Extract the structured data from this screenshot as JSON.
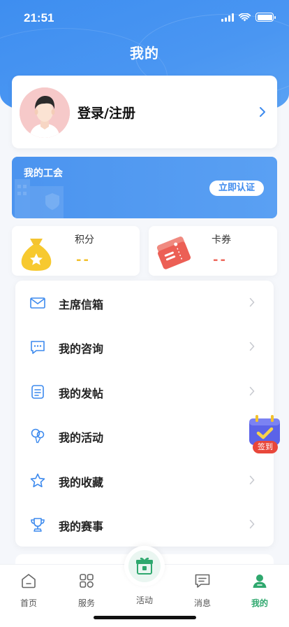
{
  "status_bar": {
    "time": "21:51"
  },
  "header": {
    "title": "我的"
  },
  "profile": {
    "login_label": "登录/注册"
  },
  "union": {
    "title": "我的工会",
    "verify_label": "立即认证"
  },
  "stats": {
    "points": {
      "label": "积分",
      "value": "--",
      "color": "#f2c12e"
    },
    "coupons": {
      "label": "卡券",
      "value": "--",
      "color": "#ee6b5f"
    }
  },
  "menu": {
    "items": [
      {
        "label": "主席信箱",
        "icon": "mail-icon"
      },
      {
        "label": "我的咨询",
        "icon": "chat-icon"
      },
      {
        "label": "我的发帖",
        "icon": "document-icon"
      },
      {
        "label": "我的活动",
        "icon": "balloon-icon"
      },
      {
        "label": "我的收藏",
        "icon": "star-icon"
      },
      {
        "label": "我的赛事",
        "icon": "trophy-icon"
      }
    ]
  },
  "signin": {
    "label": "签到"
  },
  "tabbar": {
    "tabs": [
      {
        "label": "首页",
        "icon": "home-icon"
      },
      {
        "label": "服务",
        "icon": "grid-icon"
      },
      {
        "label": "活动",
        "icon": "gift-icon"
      },
      {
        "label": "消息",
        "icon": "message-icon"
      },
      {
        "label": "我的",
        "icon": "person-icon",
        "active": true
      }
    ]
  },
  "colors": {
    "accent": "#3e8ef0",
    "active_tab": "#2fa86e",
    "icon_blue": "#3d8aee"
  }
}
